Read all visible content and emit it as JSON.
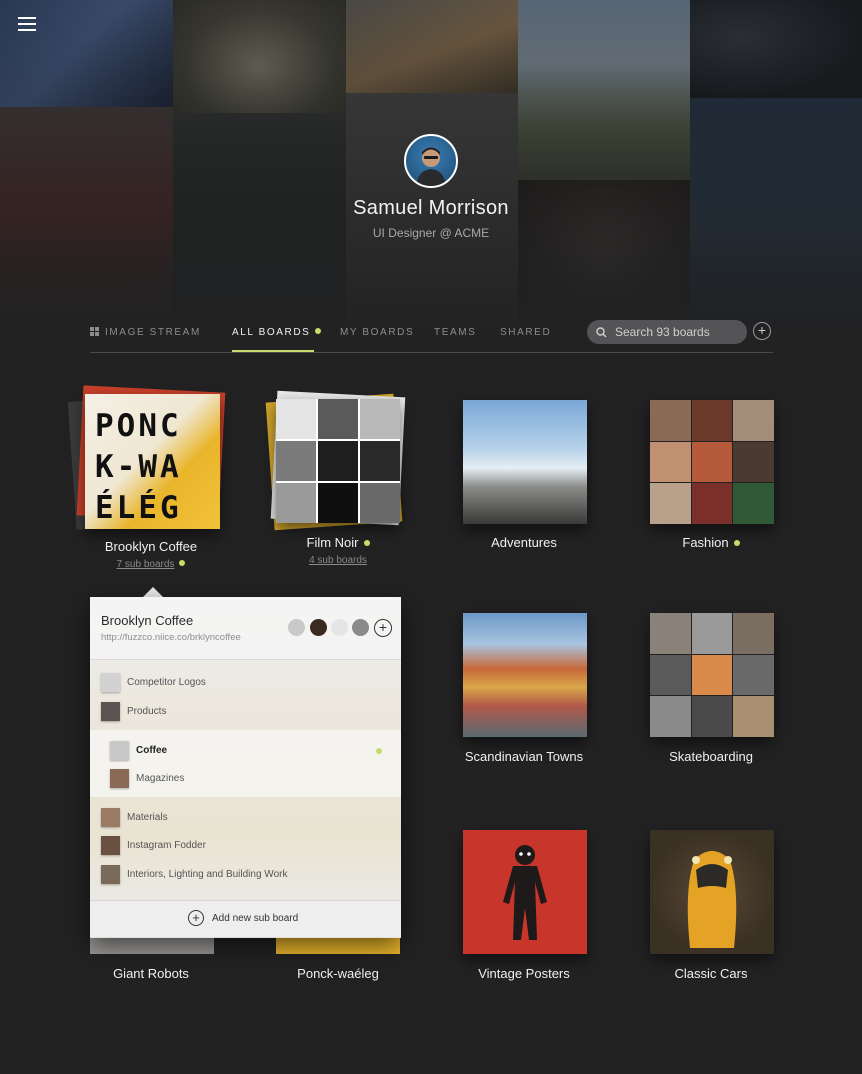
{
  "profile": {
    "name": "Samuel Morrison",
    "role": "UI Designer @ ACME"
  },
  "nav": {
    "image_stream": "IMAGE STREAM",
    "all_boards": "ALL BOARDS",
    "my_boards": "MY BOARDS",
    "teams": "TEAMS",
    "shared": "SHARED",
    "search_placeholder": "Search 93 boards",
    "add": "+"
  },
  "boards": [
    {
      "title": "Brooklyn Coffee",
      "sub": "7 sub boards",
      "dot": true
    },
    {
      "title": "Film Noir",
      "sub": "4 sub boards",
      "dot": true
    },
    {
      "title": "Adventures"
    },
    {
      "title": "Fashion",
      "dot": true
    },
    {
      "title": "Scandinavian Towns"
    },
    {
      "title": "Skateboarding"
    },
    {
      "title": "Giant Robots"
    },
    {
      "title": "Ponck-waéleg"
    },
    {
      "title": "Vintage Posters"
    },
    {
      "title": "Classic Cars"
    }
  ],
  "cover_text": {
    "line1": "PONC",
    "line2": "K-WA",
    "line3": "ÉLÉG",
    "partial": "ÉLÉG"
  },
  "popover": {
    "title": "Brooklyn Coffee",
    "url": "http://fuzzco.niice.co/brklyncoffee",
    "items": [
      "Competitor Logos",
      "Products",
      "Coffee",
      "Magazines",
      "Materials",
      "Instagram Fodder",
      "Interiors, Lighting and Building Work"
    ],
    "add_label": "Add new sub board"
  },
  "colors": {
    "accent_dot": "#c5dd66",
    "background": "#222223"
  },
  "icons": [
    "menu-icon",
    "grid-icon",
    "search-icon",
    "plus-icon"
  ]
}
